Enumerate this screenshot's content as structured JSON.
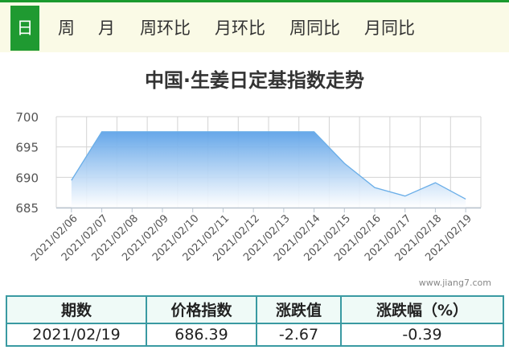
{
  "tabs": [
    {
      "label": "日",
      "active": true
    },
    {
      "label": "周",
      "active": false
    },
    {
      "label": "月",
      "active": false
    },
    {
      "label": "周环比",
      "active": false
    },
    {
      "label": "月环比",
      "active": false
    },
    {
      "label": "周同比",
      "active": false
    },
    {
      "label": "月同比",
      "active": false
    }
  ],
  "watermark": "www.jiang7.com",
  "colors": {
    "accent_green": "#1f9a31",
    "line": "#6aaee8",
    "area_top": "#5fa3e8",
    "table_border": "#3a9aa2"
  },
  "chart_data": {
    "type": "area",
    "title": "中国·生姜日定基指数走势",
    "xlabel": "",
    "ylabel": "",
    "x": [
      "2021/02/06",
      "2021/02/07",
      "2021/02/08",
      "2021/02/09",
      "2021/02/10",
      "2021/02/11",
      "2021/02/12",
      "2021/02/13",
      "2021/02/14",
      "2021/02/15",
      "2021/02/16",
      "2021/02/17",
      "2021/02/18",
      "2021/02/19"
    ],
    "series": [
      {
        "values": [
          689.5,
          697.5,
          697.5,
          697.5,
          697.5,
          697.5,
          697.5,
          697.5,
          697.5,
          692.3,
          688.3,
          686.9,
          689.1,
          686.4
        ]
      }
    ],
    "ylim": [
      685,
      700
    ],
    "yticks": [
      685,
      690,
      695,
      700
    ],
    "grid": true
  },
  "table": {
    "headers": [
      "期数",
      "价格指数",
      "涨跌值",
      "涨跌幅（%）"
    ],
    "row": [
      "2021/02/19",
      "686.39",
      "-2.67",
      "-0.39"
    ]
  }
}
